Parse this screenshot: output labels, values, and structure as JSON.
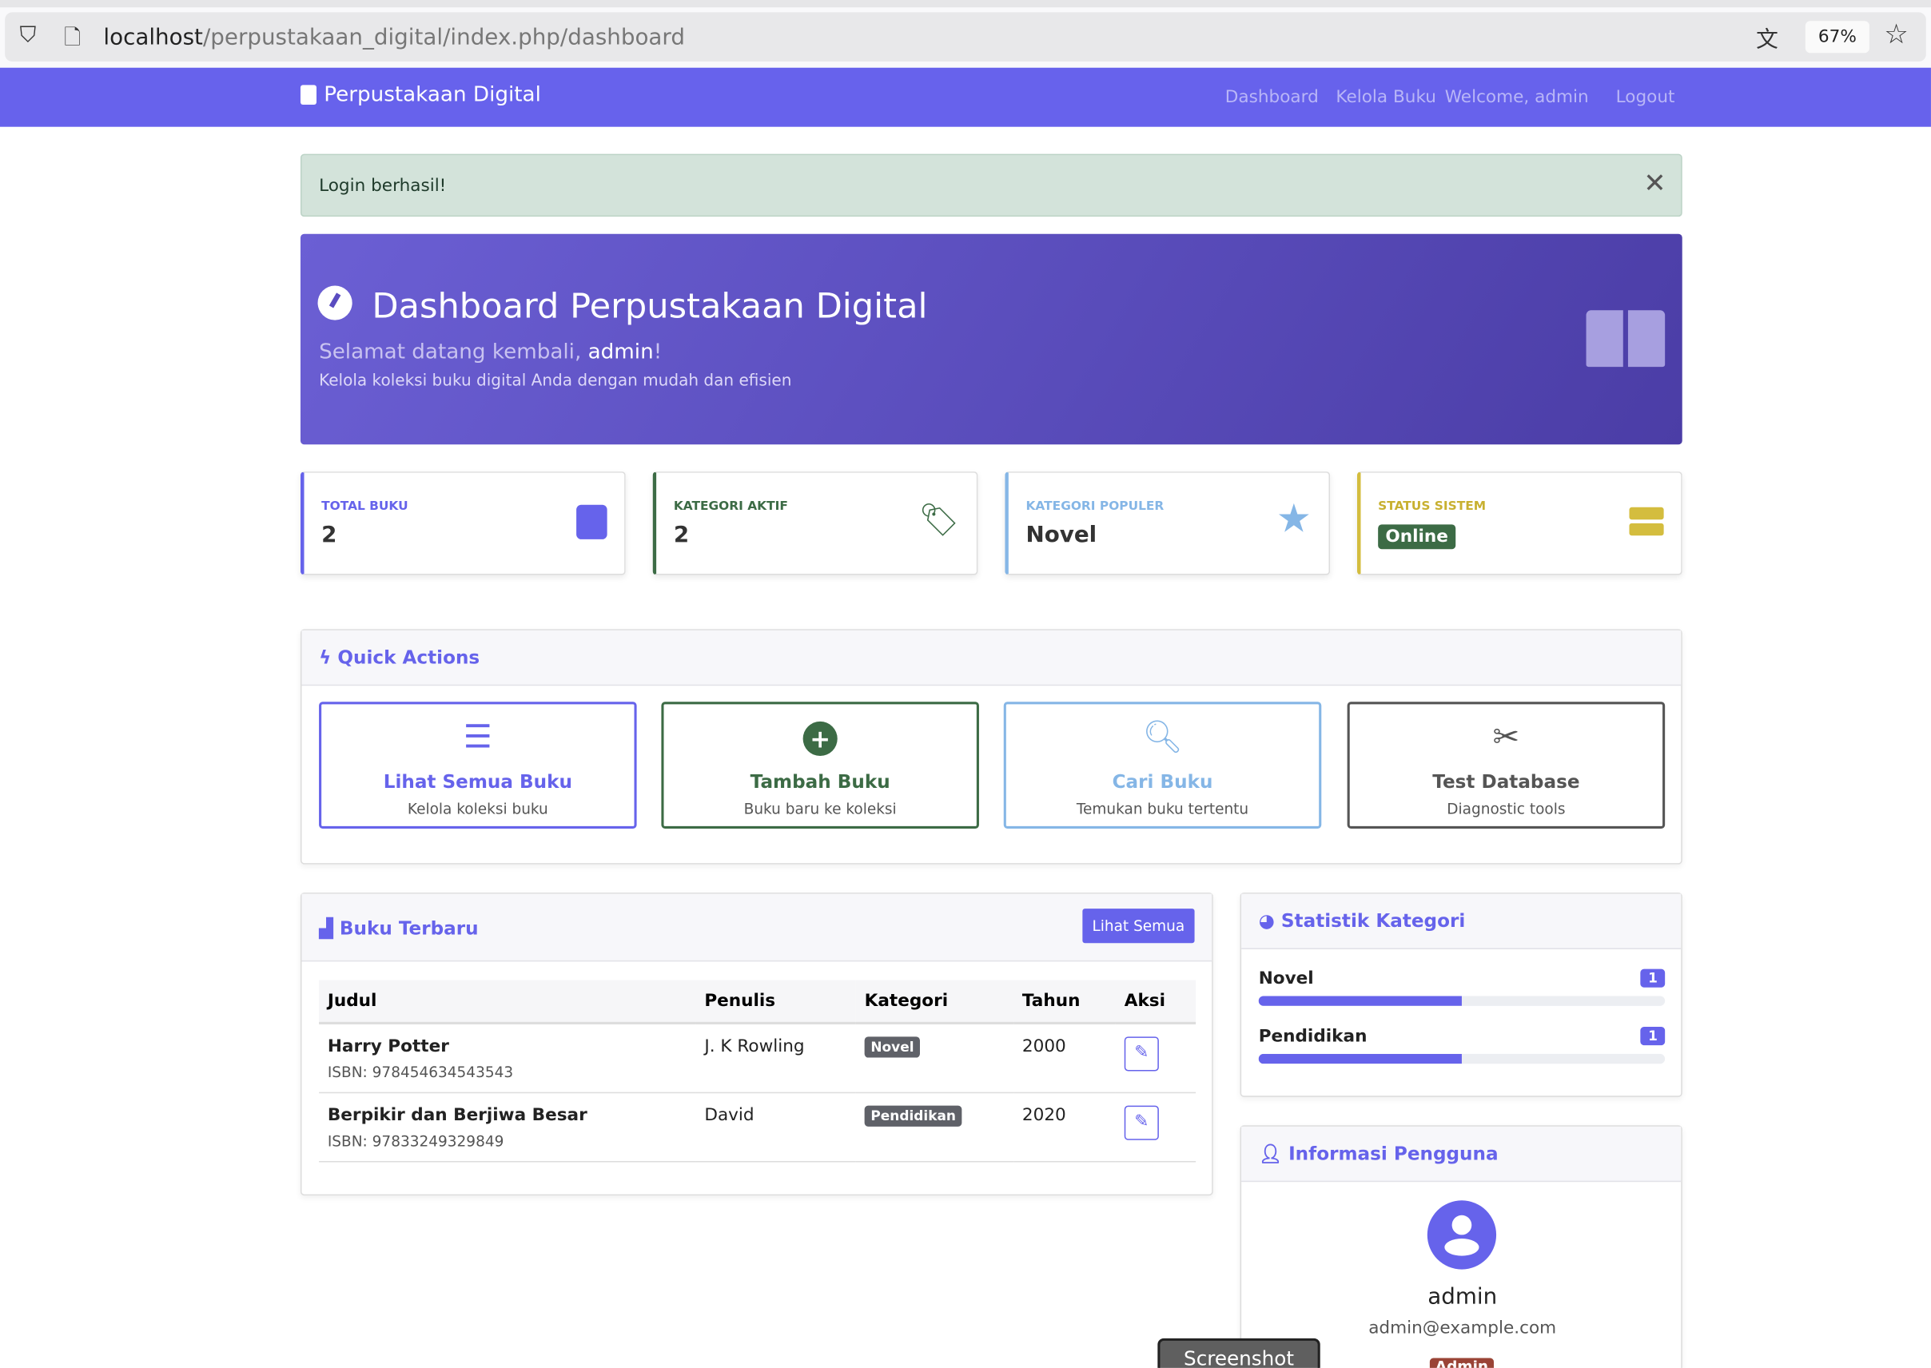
{
  "browser": {
    "url_host": "localhost",
    "url_path": "/perpustakaan_digital/index.php/dashboard",
    "zoom": "67%"
  },
  "nav": {
    "brand": "Perpustakaan Digital",
    "links": [
      "Dashboard",
      "Kelola Buku",
      "Welcome, admin",
      "Logout"
    ]
  },
  "alert": {
    "text": "Login berhasil!"
  },
  "hero": {
    "title": "Dashboard Perpustakaan Digital",
    "welcome_prefix": "Selamat datang kembali, ",
    "username": "admin",
    "welcome_suffix": "!",
    "description": "Kelola koleksi buku digital Anda dengan mudah dan efisien"
  },
  "stats": [
    {
      "label": "TOTAL BUKU",
      "value": "2",
      "color": "#6663eb",
      "icon": "book-icon"
    },
    {
      "label": "KATEGORI AKTIF",
      "value": "2",
      "color": "#3c6b45",
      "icon": "tags-icon"
    },
    {
      "label": "KATEGORI POPULER",
      "value": "Novel",
      "color": "#85b6e6",
      "icon": "star-icon"
    },
    {
      "label": "STATUS SISTEM",
      "value": "Online",
      "color": "#d4bd3e",
      "icon": "server-icon"
    }
  ],
  "quick_actions": {
    "title": "Quick Actions",
    "items": [
      {
        "title": "Lihat Semua Buku",
        "subtitle": "Kelola koleksi buku",
        "color": "#6663eb",
        "icon": "list-icon"
      },
      {
        "title": "Tambah Buku",
        "subtitle": "Buku baru ke koleksi",
        "color": "#3c6b45",
        "icon": "plus-circle-icon"
      },
      {
        "title": "Cari Buku",
        "subtitle": "Temukan buku tertentu",
        "color": "#85b6e6",
        "icon": "search-icon"
      },
      {
        "title": "Test Database",
        "subtitle": "Diagnostic tools",
        "color": "#555555",
        "icon": "tools-icon"
      }
    ]
  },
  "recent_books": {
    "title": "Buku Terbaru",
    "view_all": "Lihat Semua",
    "columns": [
      "Judul",
      "Penulis",
      "Kategori",
      "Tahun",
      "Aksi"
    ],
    "rows": [
      {
        "title": "Harry Potter",
        "isbn": "ISBN: 978454634543543",
        "author": "J. K Rowling",
        "category": "Novel",
        "year": "2000"
      },
      {
        "title": "Berpikir dan Berjiwa Besar",
        "isbn": "ISBN: 97833249329849",
        "author": "David",
        "category": "Pendidikan",
        "year": "2020"
      }
    ]
  },
  "category_stats": {
    "title": "Statistik Kategori",
    "items": [
      {
        "name": "Novel",
        "count": "1",
        "percent": 50
      },
      {
        "name": "Pendidikan",
        "count": "1",
        "percent": 50
      }
    ]
  },
  "user_info": {
    "title": "Informasi Pengguna",
    "name": "admin",
    "email": "admin@example.com",
    "role": "Admin"
  },
  "overlay": {
    "screenshot": "Screenshot"
  }
}
